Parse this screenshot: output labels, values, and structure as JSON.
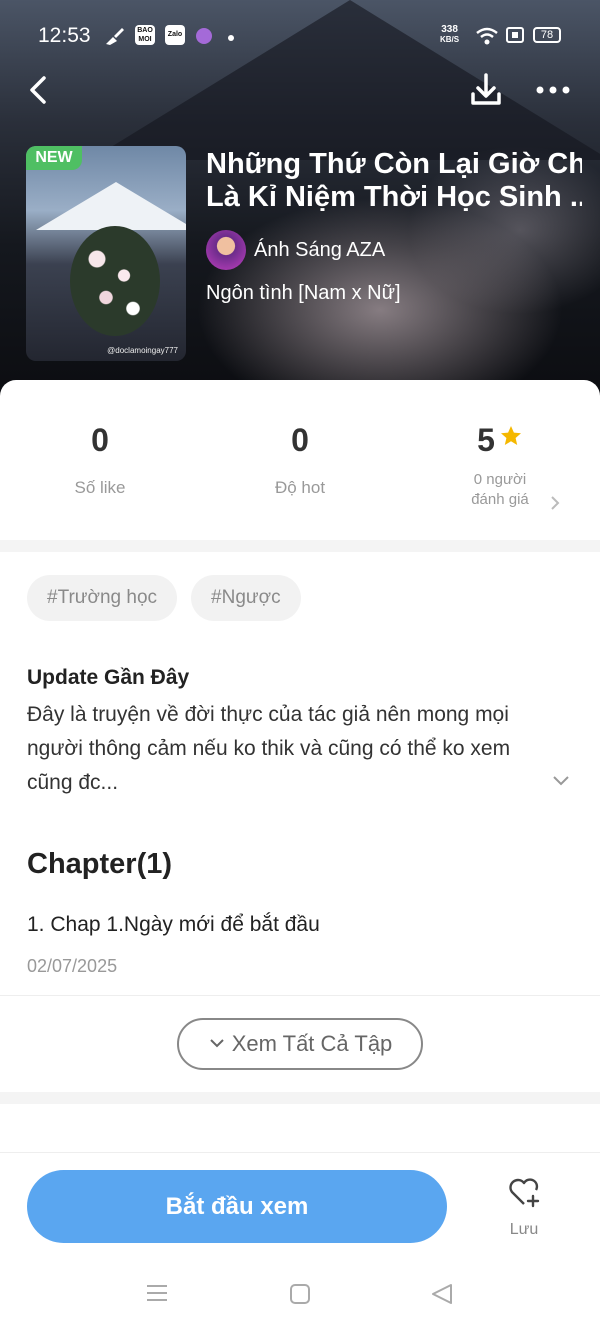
{
  "status_bar": {
    "time": "12:53",
    "app_icons": [
      "BAO MOI",
      "Zalo"
    ],
    "net_speed_value": "338",
    "net_speed_unit": "KB/S",
    "battery": "78"
  },
  "header": {
    "back_icon": "chevron-left-icon",
    "download_icon": "download-icon",
    "more_icon": "more-horizontal-icon"
  },
  "book": {
    "badge": "NEW",
    "cover_watermark": "@doclamoingay777",
    "title_line1": "Những Thứ Còn Lại Giờ Chỉ",
    "title_line2": "Là Kỉ Niệm Thời Học Sinh ...",
    "author": "Ánh Sáng AZA",
    "genre": "Ngôn tình [Nam x Nữ]"
  },
  "stats": {
    "likes_value": "0",
    "likes_label": "Số like",
    "hot_value": "0",
    "hot_label": "Độ hot",
    "rating_value": "5",
    "rating_label_1": "0 người",
    "rating_label_2": "đánh giá"
  },
  "tags": [
    "#Trường học",
    "#Ngược"
  ],
  "update": {
    "title": "Update Gần Đây",
    "text": "Đây là truyện về đời thực của tác giả nên mong mọi người thông cảm nếu ko thik và cũng có thể ko xem cũng đc..."
  },
  "chapters": {
    "heading": "Chapter(1)",
    "items": [
      {
        "title": "1. Chap 1.Ngày mới để bắt đầu",
        "date": "02/07/2025"
      }
    ],
    "view_all_label": "Xem Tất Cả Tập"
  },
  "actions": {
    "start_label": "Bắt đầu xem",
    "save_label": "Lưu"
  },
  "colors": {
    "primary_button": "#5aa6f0",
    "new_badge": "#4fbf63",
    "star": "#f5b800"
  }
}
